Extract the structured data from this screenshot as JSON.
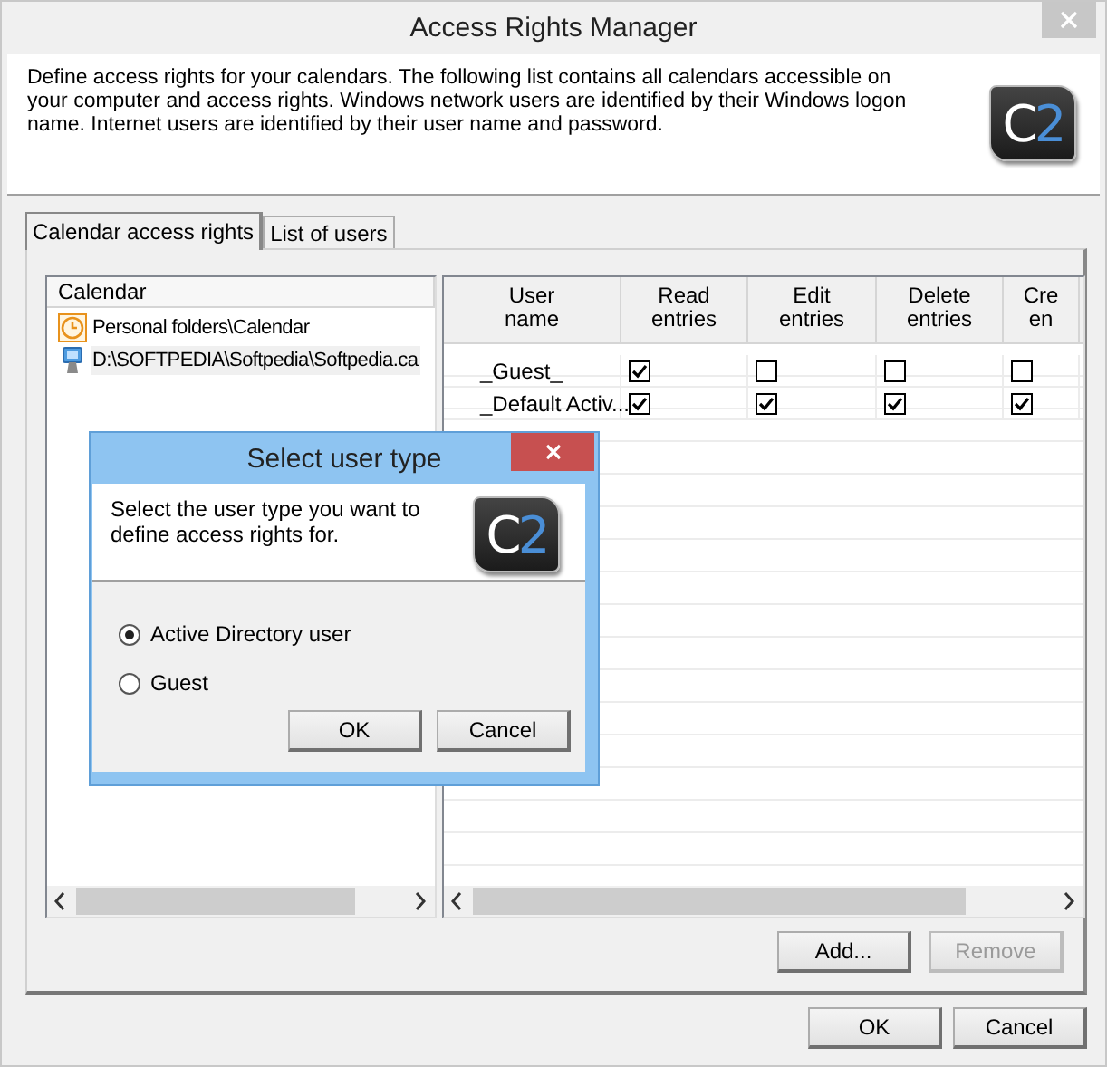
{
  "window": {
    "title": "Access Rights Manager"
  },
  "header": {
    "description": "Define access rights for your calendars. The following list contains all calendars accessible on your computer and access rights. Windows network users are identified by their Windows logon name. Internet users are identified by their user name and password.",
    "logo": "C2"
  },
  "tabs": [
    {
      "label": "Calendar access rights",
      "selected": true
    },
    {
      "label": "List of users",
      "selected": false
    }
  ],
  "calendar_list": {
    "heading": "Calendar",
    "items": [
      {
        "kind": "personal",
        "label": "Personal folders\\Calendar",
        "selected": false
      },
      {
        "kind": "file",
        "label": "D:\\SOFTPEDIA\\Softpedia\\Softpedia.ca",
        "selected": true
      }
    ]
  },
  "rights_table": {
    "columns": [
      "User\nname",
      "Read\nentries",
      "Edit\nentries",
      "Delete\nentries",
      "Cre\nen"
    ],
    "rows": [
      {
        "user": "_Guest_",
        "rights": [
          true,
          false,
          false,
          false
        ]
      },
      {
        "user": "_Default Activ...",
        "rights": [
          true,
          true,
          true,
          true
        ]
      }
    ]
  },
  "table_buttons": [
    {
      "label": "Add...",
      "disabled": false
    },
    {
      "label": "Remove",
      "disabled": true
    }
  ],
  "footer_buttons": [
    "OK",
    "Cancel"
  ],
  "dialog": {
    "title": "Select user type",
    "prompt": "Select the user type you want to define access rights for.",
    "logo": "C2",
    "options": [
      {
        "label": "Active Directory user",
        "selected": true
      },
      {
        "label": "Guest",
        "selected": false
      }
    ],
    "buttons": [
      "OK",
      "Cancel"
    ]
  }
}
